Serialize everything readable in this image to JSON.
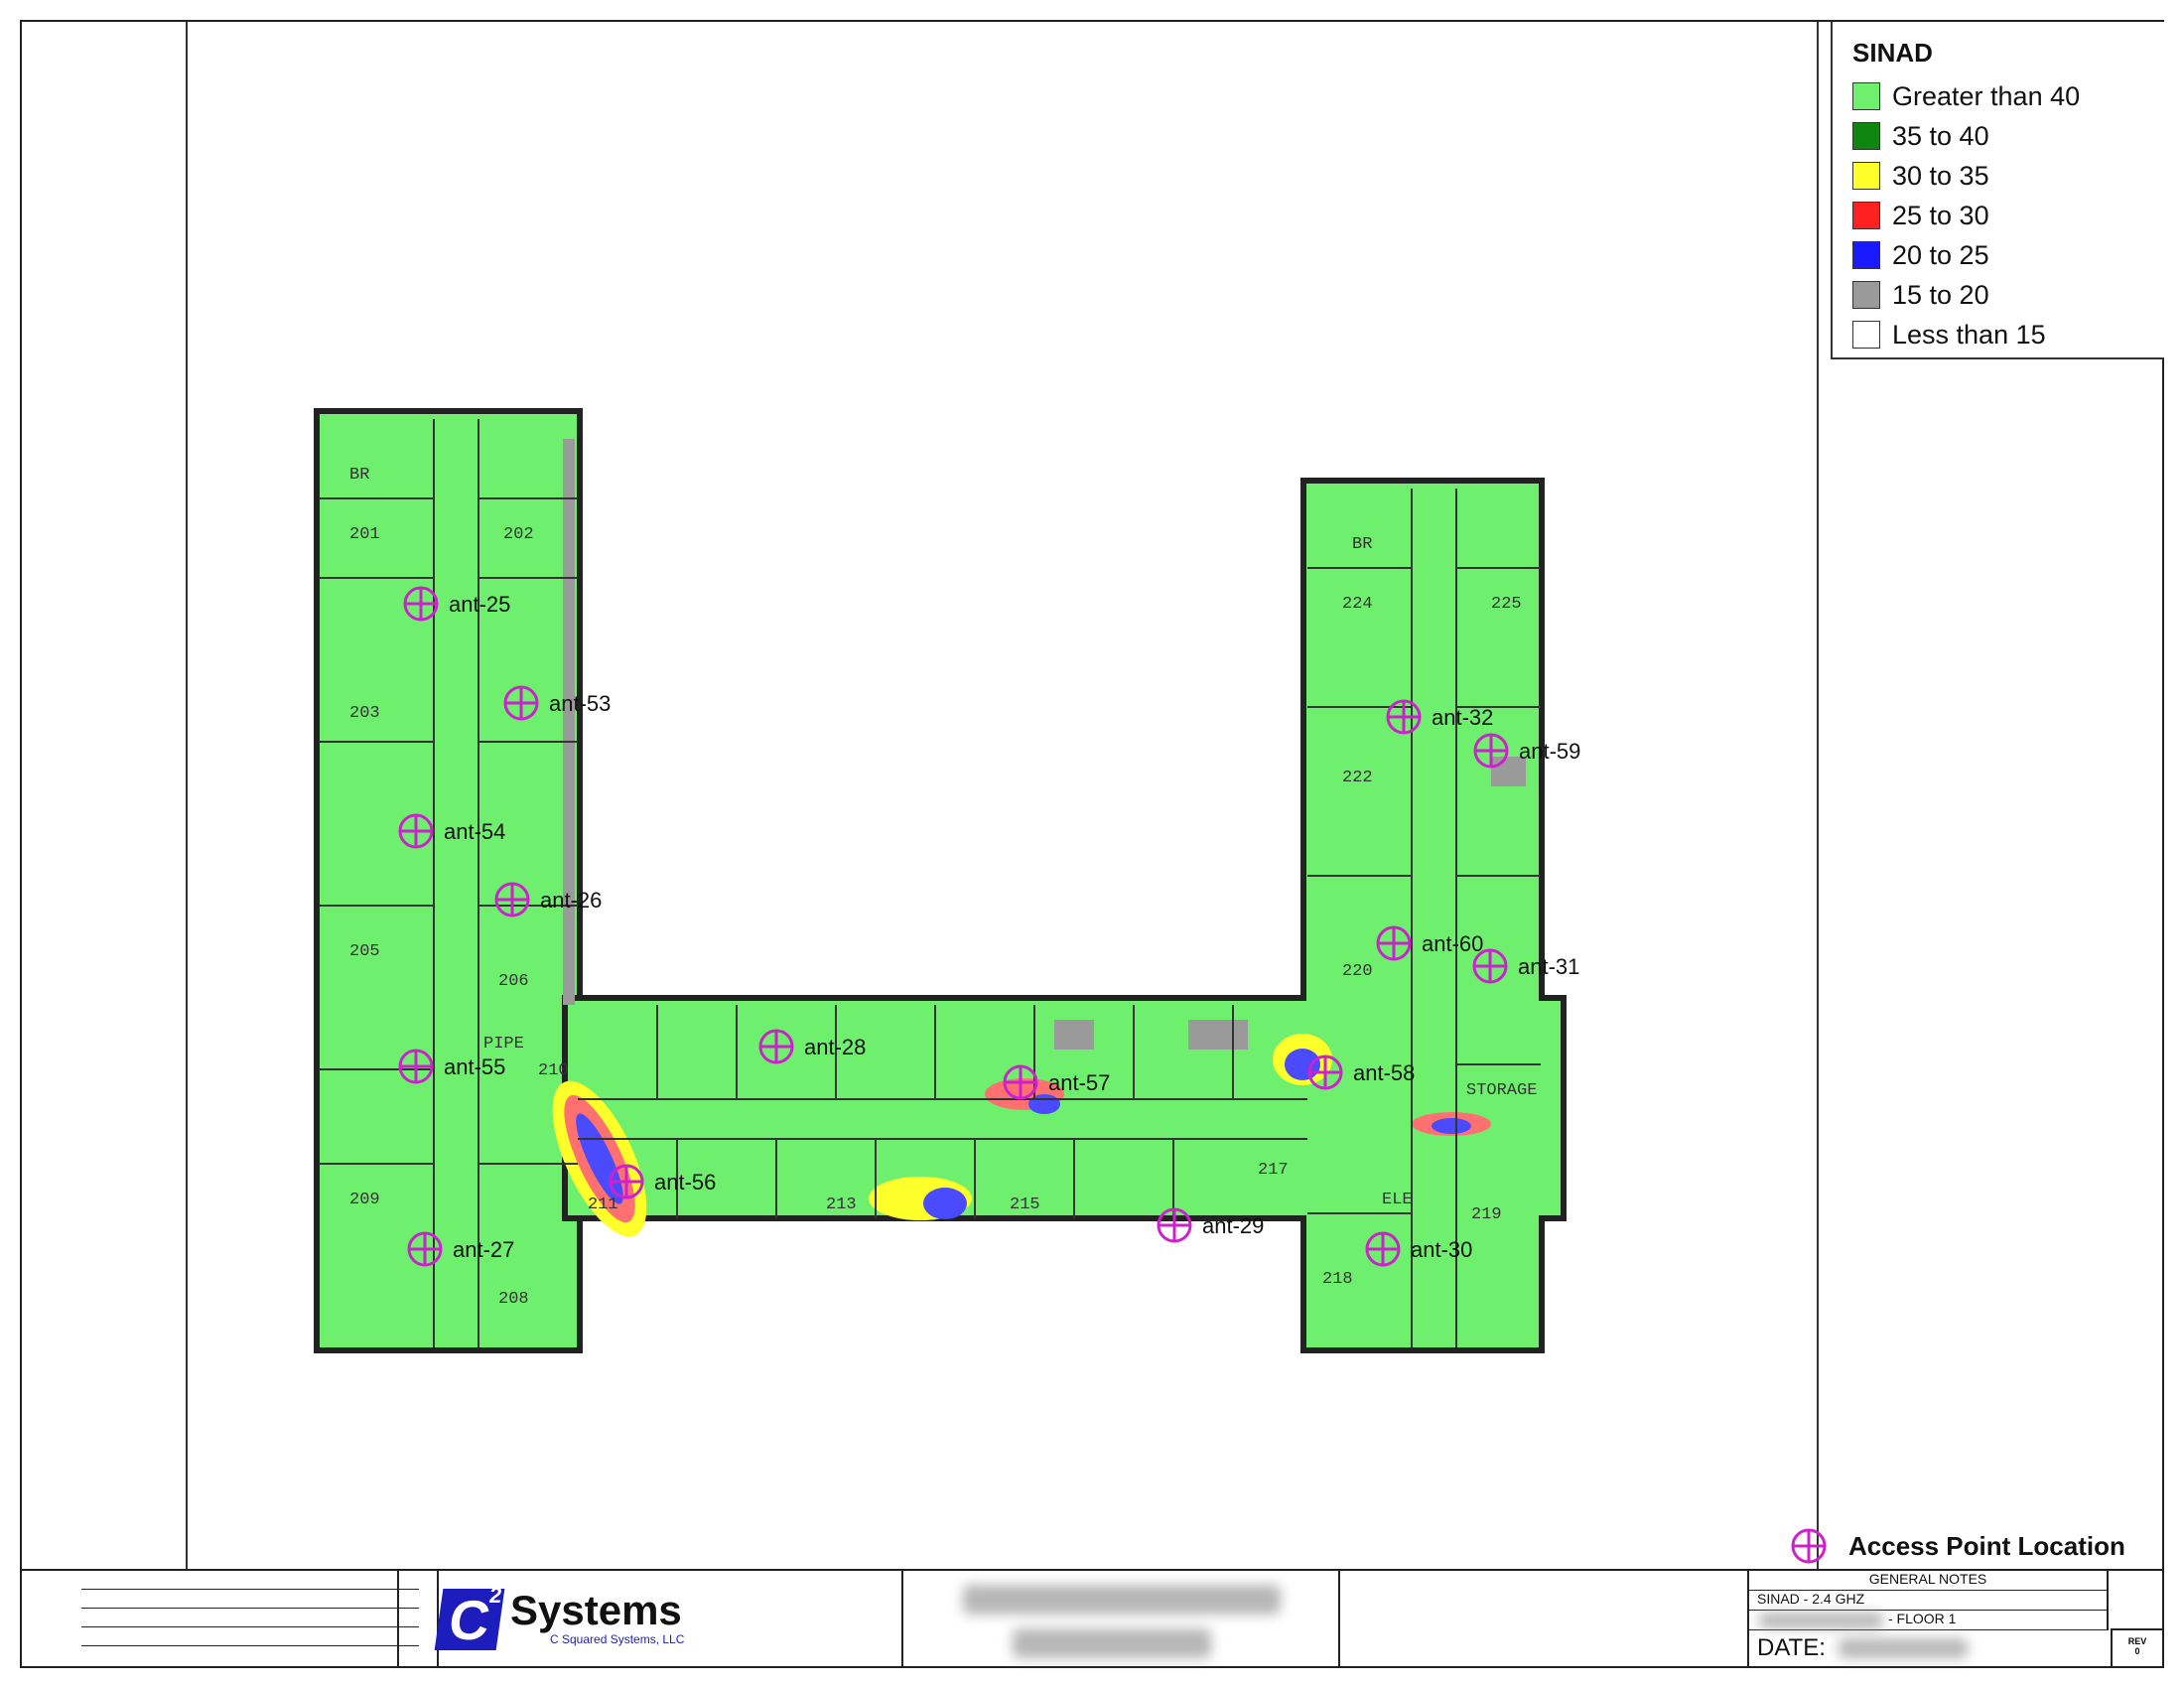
{
  "legend": {
    "title": "SINAD",
    "items": [
      {
        "label": "Greater than 40",
        "color": "#6ef06e"
      },
      {
        "label": "35 to 40",
        "color": "#0f860f"
      },
      {
        "label": "30 to 35",
        "color": "#ffff2a"
      },
      {
        "label": "25 to 30",
        "color": "#ff2020"
      },
      {
        "label": "20 to 25",
        "color": "#1a1aff"
      },
      {
        "label": "15 to 20",
        "color": "#9a9a9a"
      },
      {
        "label": "Less than 15",
        "color": "#ffffff"
      }
    ]
  },
  "access_points": [
    {
      "id": "ant-25"
    },
    {
      "id": "ant-53"
    },
    {
      "id": "ant-54"
    },
    {
      "id": "ant-26"
    },
    {
      "id": "ant-55"
    },
    {
      "id": "ant-27"
    },
    {
      "id": "ant-56"
    },
    {
      "id": "ant-28"
    },
    {
      "id": "ant-57"
    },
    {
      "id": "ant-29"
    },
    {
      "id": "ant-58"
    },
    {
      "id": "ant-30"
    },
    {
      "id": "ant-32"
    },
    {
      "id": "ant-59"
    },
    {
      "id": "ant-60"
    },
    {
      "id": "ant-31"
    }
  ],
  "rooms": [
    "201",
    "202",
    "203",
    "205",
    "206",
    "209",
    "208",
    "210",
    "211",
    "213",
    "215",
    "217",
    "218",
    "219",
    "220",
    "222",
    "224",
    "225",
    "BR",
    "BR",
    "STORAGE",
    "ELE",
    "PIPE"
  ],
  "ap_key_label": "Access Point Location",
  "title_block": {
    "company_name": "Systems",
    "company_sub": "C Squared Systems, LLC",
    "notes_header": "GENERAL NOTES",
    "notes_line1": "SINAD - 2.4 GHZ",
    "notes_line2": "- FLOOR 1",
    "date_label": "DATE:",
    "rev_label": "REV",
    "rev_value": "0"
  }
}
